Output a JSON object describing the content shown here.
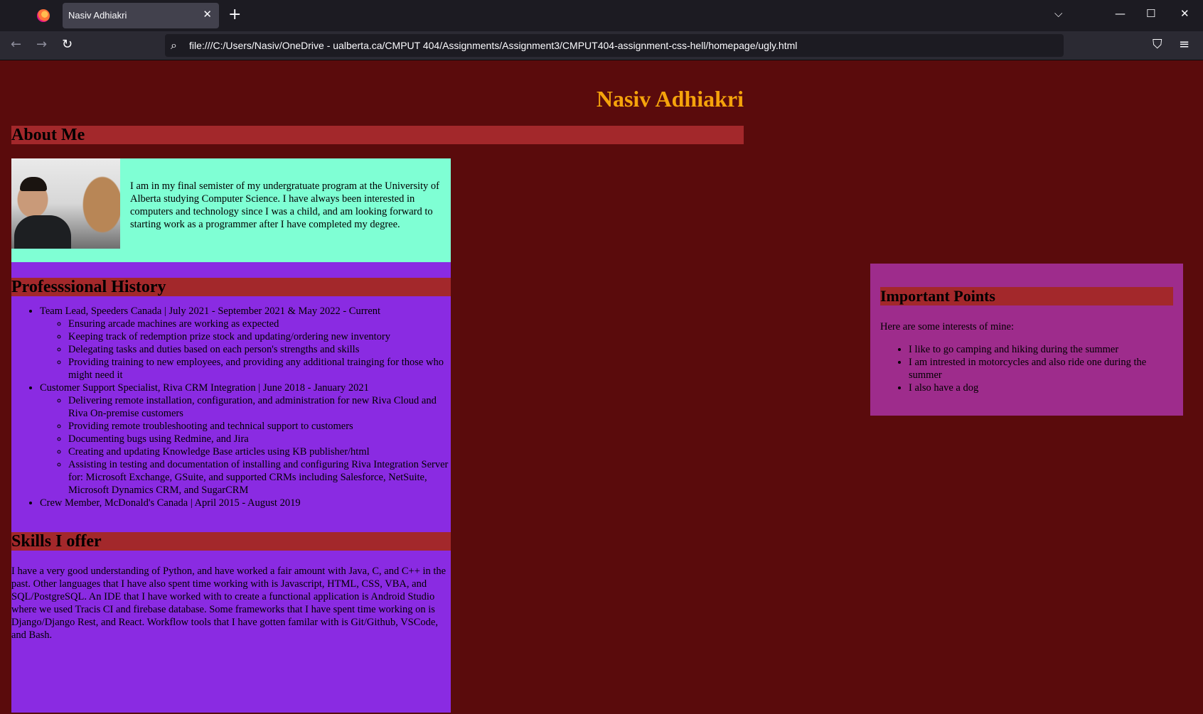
{
  "browser": {
    "tab_title": "Nasiv Adhiakri",
    "tab_close": "✕",
    "new_tab": "+",
    "tab_list": "⌵",
    "minimize": "—",
    "maximize": "☐",
    "close": "✕",
    "back": "←",
    "forward": "→",
    "reload": "↻",
    "url": "file:///C:/Users/Nasiv/OneDrive - ualberta.ca/CMPUT 404/Assignments/Assignment3/CMPUT404-assignment-css-hell/homepage/ugly.html",
    "pocket": "⛉",
    "menu": "≡",
    "search_glyph": "⌕"
  },
  "page": {
    "name": "Nasiv Adhiakri",
    "about": {
      "heading": "About Me",
      "text": "I am in my final semister of my undergratuate program at the University of Alberta studying Computer Science. I have always been interested in computers and technology since I was a child, and am looking forward to starting work as a programmer after I have completed my degree."
    },
    "history": {
      "heading": "Professsional History",
      "jobs": [
        {
          "title": "Team Lead, Speeders Canada | July 2021 - September 2021 & May 2022 - Current",
          "duties": [
            "Ensuring arcade machines are working as expected",
            "Keeping track of redemption prize stock and updating/ordering new inventory",
            "Delegating tasks and duties based on each person's strengths and skills",
            "Providing training to new employees, and providing any additional trainging for those who might need it"
          ]
        },
        {
          "title": "Customer Support Specialist, Riva CRM Integration | June 2018 - January 2021",
          "duties": [
            "Delivering remote installation, configuration, and administration for new Riva Cloud and Riva On-premise customers",
            "Providing remote troubleshooting and technical support to customers",
            "Documenting bugs using Redmine, and Jira",
            "Creating and updating Knowledge Base articles using KB publisher/html",
            "Assisting in testing and documentation of installing and configuring Riva Integration Server for: Microsoft Exchange, GSuite, and supported CRMs including Salesforce, NetSuite, Microsoft Dynamics CRM, and SugarCRM"
          ]
        },
        {
          "title": "Crew Member, McDonald's Canada | April 2015 - August 2019",
          "duties": []
        }
      ]
    },
    "skills": {
      "heading": "Skills I offer",
      "text": "I have a very good understanding of Python, and have worked a fair amount with Java, C, and C++ in the past. Other languages that I have also spent time working with is Javascript, HTML, CSS, VBA, and SQL/PostgreSQL. An IDE that I have worked with to create a functional application is Android Studio where we used Tracis CI and firebase database. Some frameworks that I have spent time working on is Django/Django Rest, and React. Workflow tools that I have gotten familar with is Git/Github, VSCode, and Bash."
    },
    "important": {
      "heading": "Important Points",
      "intro": "Here are some interests of mine:",
      "items": [
        "I like to go camping and hiking during the summer",
        "I am intrested in motorcycles and also ride one during the summer",
        "I also have a dog"
      ]
    }
  },
  "colors": {
    "page_bg": "#5a0b0c",
    "name": "#f5a30b",
    "heading_bar": "#a3282b",
    "about_bg": "#7fffd4",
    "column_bg": "#8a2be2",
    "side_bg": "#9e2c8c"
  }
}
